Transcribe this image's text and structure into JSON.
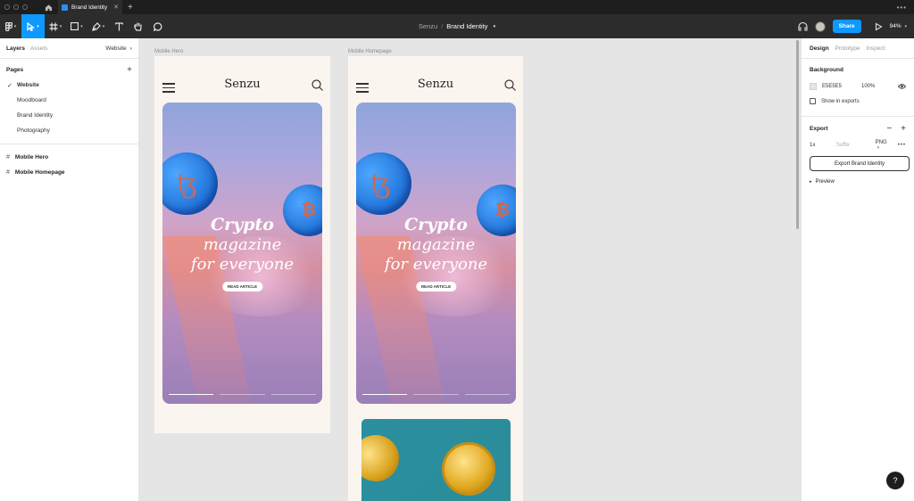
{
  "window": {
    "tab_title": "Brand Identity",
    "close_glyph": "✕",
    "new_tab_glyph": "+",
    "more_glyph": "•••"
  },
  "toolbar": {
    "breadcrumb_project": "Senzu",
    "breadcrumb_separator": "/",
    "breadcrumb_file": "Brand Identity",
    "share_label": "Share",
    "zoom_level": "94%",
    "accent_color": "#0d99ff"
  },
  "left_panel": {
    "tab_layers": "Layers",
    "tab_assets": "Assets",
    "page_selector": "Website",
    "pages_heading": "Pages",
    "add_glyph": "+",
    "pages": [
      {
        "label": "Website",
        "current": true
      },
      {
        "label": "Moodboard",
        "current": false
      },
      {
        "label": "Brand Identity",
        "current": false
      },
      {
        "label": "Photography",
        "current": false
      }
    ],
    "check_glyph": "✓",
    "frame_glyph": "#",
    "layers": [
      {
        "label": "Mobile Hero"
      },
      {
        "label": "Mobile Homepage"
      }
    ]
  },
  "canvas": {
    "frames": [
      {
        "label": "Mobile Hero",
        "brand": "Senzu",
        "headline": [
          "Crypto",
          "magazine",
          "for everyone"
        ],
        "cta": "READ ARTICLE"
      },
      {
        "label": "Mobile Homepage",
        "brand": "Senzu",
        "headline": [
          "Crypto",
          "magazine",
          "for everyone"
        ],
        "cta": "READ ARTICLE"
      }
    ],
    "coin_a_glyph": "ꜩ",
    "coin_b_glyph": "₿"
  },
  "right_panel": {
    "tab_design": "Design",
    "tab_prototype": "Prototype",
    "tab_inspect": "Inspect",
    "background_heading": "Background",
    "background_color": "E5E5E5",
    "background_opacity": "100%",
    "show_in_exports": "Show in exports",
    "export_heading": "Export",
    "export_minus": "−",
    "export_plus": "+",
    "export_scale": "1x",
    "export_suffix_placeholder": "Suffix",
    "export_format": "PNG",
    "export_more": "•••",
    "export_button": "Export Brand Identity",
    "preview_label": "Preview",
    "help_glyph": "?"
  }
}
